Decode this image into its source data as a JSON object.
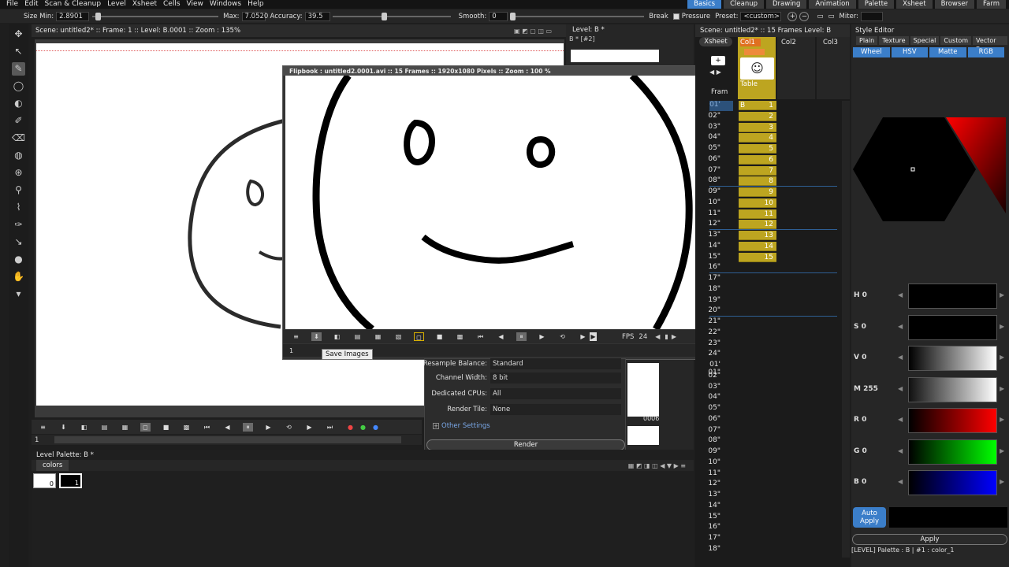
{
  "menubar": {
    "items": [
      "File",
      "Edit",
      "Scan & Cleanup",
      "Level",
      "Xsheet",
      "Cells",
      "View",
      "Windows",
      "Help"
    ],
    "rooms": [
      "Basics",
      "Cleanup",
      "Drawing",
      "Animation",
      "Palette",
      "Xsheet",
      "Browser",
      "Farm"
    ],
    "active_room": "Basics"
  },
  "tool_options": {
    "size_min_label": "Size Min:",
    "size_min": "2.8901",
    "max_label": "Max:",
    "max": "7.0520",
    "accuracy_label": "Accuracy:",
    "accuracy": "39.5",
    "smooth_label": "Smooth:",
    "smooth": "0",
    "break_label": "Break",
    "pressure_label": "Pressure",
    "preset_label": "Preset:",
    "preset": "<custom>",
    "miter_label": "Miter:"
  },
  "viewer": {
    "header": "Scene: untitled2*  ::  Frame: 1  ::  Level: B.0001  ::  Zoom : 135%",
    "frame_field": "1"
  },
  "level_strip": {
    "header": "Level: B *",
    "sub": "B *  [#2]",
    "frame_tag": "0006"
  },
  "flipbook": {
    "title": "Flipbook : untitled2.0001.avi  ::  15 Frames  ::  1920x1080 Pixels  ::  Zoom : 100 %",
    "fps_label": "FPS",
    "fps": "24",
    "frame_field": "1",
    "tooltip": "Save Images"
  },
  "output_settings": {
    "resample_label": "Resample Balance:",
    "resample": "Standard",
    "channel_label": "Channel Width:",
    "channel": "8 bit",
    "cpu_label": "Dedicated CPUs:",
    "cpu": "All",
    "tile_label": "Render Tile:",
    "tile": "None",
    "other_label": "Other Settings",
    "render_label": "Render"
  },
  "level_palette": {
    "header": "Level Palette: B *",
    "tab": "colors",
    "chips": [
      "0",
      "1"
    ]
  },
  "xsheet": {
    "header": "Scene: untitled2*  ::  15 Frames  Level: B",
    "xsheet_button": "Xsheet",
    "frame_label": "Fram",
    "columns": [
      "Col1",
      "Col2",
      "Col3"
    ],
    "col1_level": "Table",
    "frames_a": [
      "01'",
      "02\"",
      "03\"",
      "04\"",
      "05\"",
      "06\"",
      "07\"",
      "08\"",
      "09\"",
      "10\"",
      "11\"",
      "12\"",
      "13\"",
      "14\"",
      "15\"",
      "16\"",
      "17\"",
      "18\"",
      "19\"",
      "20\"",
      "21\"",
      "22\"",
      "23\"",
      "24\""
    ],
    "frames_b": [
      "01' 01\"",
      "02\"",
      "03\"",
      "04\"",
      "05\"",
      "06\"",
      "07\"",
      "08\"",
      "09\"",
      "10\"",
      "11\"",
      "12\"",
      "13\"",
      "14\"",
      "15\"",
      "16\"",
      "17\"",
      "18\""
    ],
    "cells": [
      "B",
      "2",
      "3",
      "4",
      "5",
      "6",
      "7",
      "8",
      "9",
      "10",
      "11",
      "12",
      "13",
      "14",
      "15"
    ],
    "first_cell_level": "B",
    "first_cell_number": "1"
  },
  "style_editor": {
    "title": "Style Editor",
    "tabs": [
      "Plain",
      "Texture",
      "Special",
      "Custom",
      "Vector Br"
    ],
    "color_tabs": [
      "Wheel",
      "HSV",
      "Matte",
      "RGB"
    ],
    "channels": [
      {
        "name": "H",
        "value": "0"
      },
      {
        "name": "S",
        "value": "0"
      },
      {
        "name": "V",
        "value": "0"
      },
      {
        "name": "M",
        "value": "255"
      },
      {
        "name": "R",
        "value": "0"
      },
      {
        "name": "G",
        "value": "0"
      },
      {
        "name": "B",
        "value": "0"
      }
    ],
    "auto_apply": "Auto Apply",
    "apply": "Apply",
    "status": "[LEVEL]  Palette : B | #1 : color_1"
  },
  "colors": {
    "accent": "#3b7ec9",
    "cell": "#bda520"
  }
}
